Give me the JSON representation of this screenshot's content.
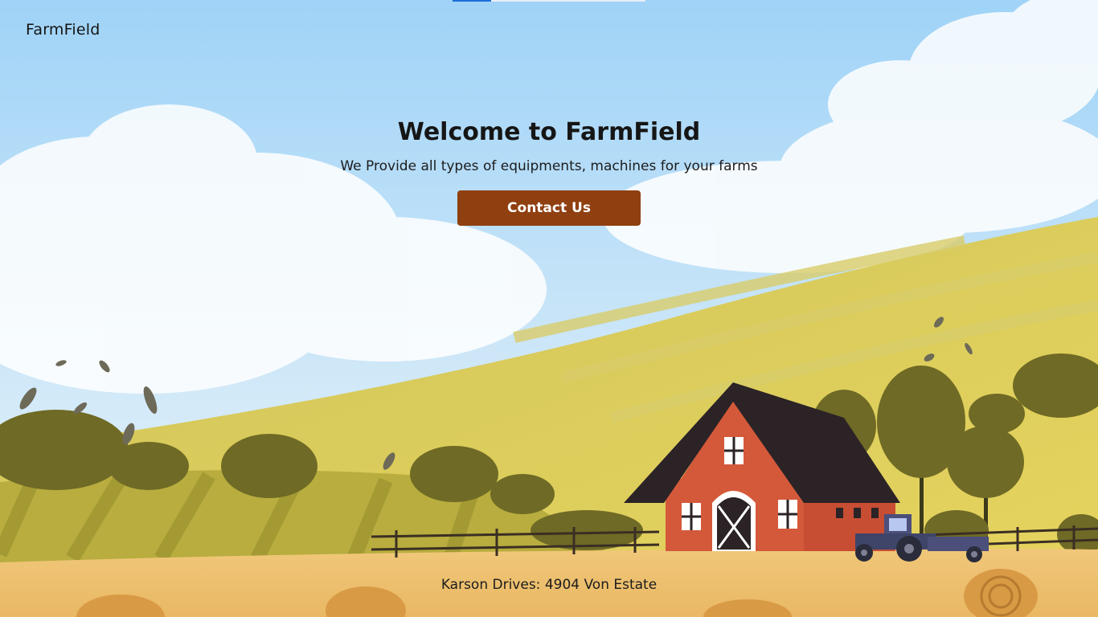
{
  "header": {
    "brand": "FarmField"
  },
  "hero": {
    "title": "Welcome to FarmField",
    "subtitle": "We Provide all types of equipments, machines for your farms",
    "cta_label": "Contact Us"
  },
  "footer": {
    "address": "Karson Drives: 4904 Von Estate"
  },
  "loading_bar": {
    "progress_fraction": 0.2
  },
  "colors": {
    "cta": "#8f3f10",
    "sky": "#9fd3f7",
    "barn": "#d4593a",
    "field": "#e2c760",
    "progress": "#1b6fd8"
  }
}
